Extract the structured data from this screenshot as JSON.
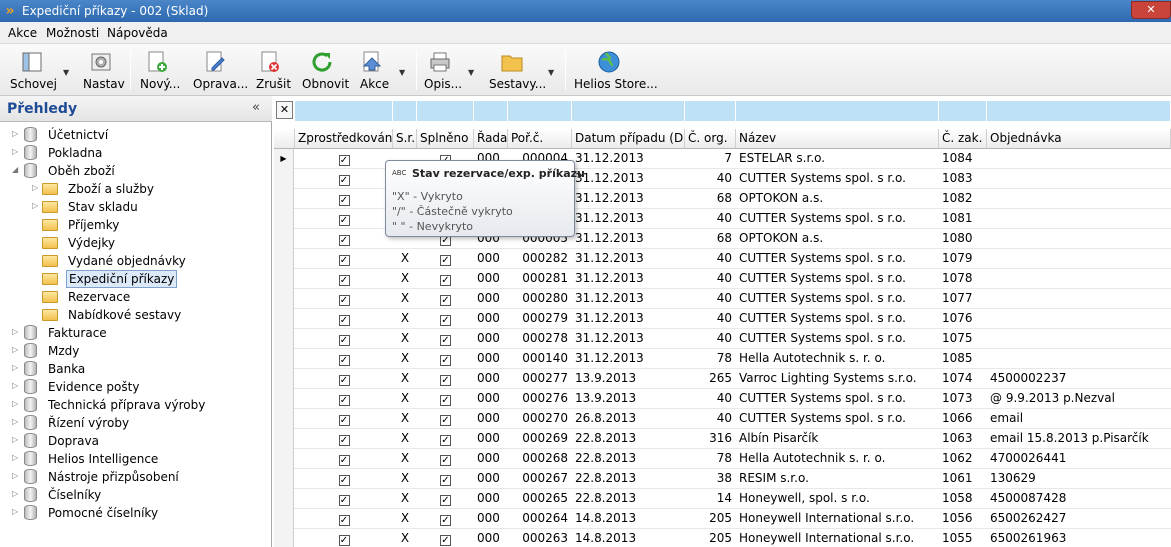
{
  "window": {
    "title": "Expediční příkazy - 002 (Sklad)",
    "close_glyph": "✕"
  },
  "menu": [
    "Akce",
    "Možnosti",
    "Nápověda"
  ],
  "toolbar": {
    "schovej": "Schovej",
    "nastav": "Nastav",
    "novy": "Nový...",
    "oprava": "Oprava...",
    "zrusit": "Zrušit",
    "obnovit": "Obnovit",
    "akce": "Akce",
    "opis": "Opis...",
    "sestavy": "Sestavy...",
    "helios_store": "Helios Store..."
  },
  "sidebar": {
    "title": "Přehledy",
    "collapse_glyph": "«",
    "items": [
      {
        "label": "Účetnictví",
        "level": 0,
        "type": "db",
        "expanded": false
      },
      {
        "label": "Pokladna",
        "level": 0,
        "type": "db",
        "expanded": false
      },
      {
        "label": "Oběh zboží",
        "level": 0,
        "type": "db",
        "expanded": true
      },
      {
        "label": "Zboží a služby",
        "level": 1,
        "type": "folder",
        "expandable": true
      },
      {
        "label": "Stav skladu",
        "level": 1,
        "type": "folder",
        "expandable": true
      },
      {
        "label": "Příjemky",
        "level": 1,
        "type": "folder",
        "expandable": false
      },
      {
        "label": "Výdejky",
        "level": 1,
        "type": "folder",
        "expandable": false
      },
      {
        "label": "Vydané objednávky",
        "level": 1,
        "type": "folder",
        "expandable": false
      },
      {
        "label": "Expediční příkazy",
        "level": 1,
        "type": "folder",
        "expandable": false,
        "selected": true
      },
      {
        "label": "Rezervace",
        "level": 1,
        "type": "folder",
        "expandable": false
      },
      {
        "label": "Nabídkové sestavy",
        "level": 1,
        "type": "folder",
        "expandable": false
      },
      {
        "label": "Fakturace",
        "level": 0,
        "type": "db",
        "expanded": false
      },
      {
        "label": "Mzdy",
        "level": 0,
        "type": "db",
        "expanded": false
      },
      {
        "label": "Banka",
        "level": 0,
        "type": "db",
        "expanded": false
      },
      {
        "label": "Evidence pošty",
        "level": 0,
        "type": "db",
        "expanded": false
      },
      {
        "label": "Technická příprava výroby",
        "level": 0,
        "type": "db",
        "expanded": false
      },
      {
        "label": "Řízení výroby",
        "level": 0,
        "type": "db",
        "expanded": false
      },
      {
        "label": "Doprava",
        "level": 0,
        "type": "db",
        "expanded": false
      },
      {
        "label": "Helios Intelligence",
        "level": 0,
        "type": "db",
        "expanded": false
      },
      {
        "label": "Nástroje přizpůsobení",
        "level": 0,
        "type": "db",
        "expanded": false
      },
      {
        "label": "Číselníky",
        "level": 0,
        "type": "db",
        "expanded": false
      },
      {
        "label": "Pomocné číselníky",
        "level": 0,
        "type": "db",
        "expanded": false
      }
    ]
  },
  "grid": {
    "filter_close": "✕",
    "columns": [
      "Zprostředkováno",
      "S.r.",
      "Splněno",
      "Řada",
      "Poř.č.",
      "Datum případu (D...",
      "Č. org.",
      "Název",
      "Č. zak.",
      "Objednávka"
    ],
    "rows": [
      [
        "1",
        "",
        "1",
        "000",
        "000004",
        "31.12.2013",
        "7",
        "ESTELAR s.r.o.",
        "1084",
        ""
      ],
      [
        "1",
        "",
        "1",
        "000",
        "000003",
        "31.12.2013",
        "40",
        "CUTTER Systems spol. s r.o.",
        "1083",
        ""
      ],
      [
        "1",
        "",
        "1",
        "000",
        "000002",
        "31.12.2013",
        "68",
        "OPTOKON a.s.",
        "1082",
        ""
      ],
      [
        "1",
        "",
        "1",
        "000",
        "000001",
        "31.12.2013",
        "40",
        "CUTTER Systems spol. s r.o.",
        "1081",
        ""
      ],
      [
        "1",
        "",
        "1",
        "000",
        "000005",
        "31.12.2013",
        "68",
        "OPTOKON a.s.",
        "1080",
        ""
      ],
      [
        "1",
        "X",
        "1",
        "000",
        "000282",
        "31.12.2013",
        "40",
        "CUTTER Systems spol. s r.o.",
        "1079",
        ""
      ],
      [
        "1",
        "X",
        "1",
        "000",
        "000281",
        "31.12.2013",
        "40",
        "CUTTER Systems spol. s r.o.",
        "1078",
        ""
      ],
      [
        "1",
        "X",
        "1",
        "000",
        "000280",
        "31.12.2013",
        "40",
        "CUTTER Systems spol. s r.o.",
        "1077",
        ""
      ],
      [
        "1",
        "X",
        "1",
        "000",
        "000279",
        "31.12.2013",
        "40",
        "CUTTER Systems spol. s r.o.",
        "1076",
        ""
      ],
      [
        "1",
        "X",
        "1",
        "000",
        "000278",
        "31.12.2013",
        "40",
        "CUTTER Systems spol. s r.o.",
        "1075",
        ""
      ],
      [
        "1",
        "X",
        "1",
        "000",
        "000140",
        "31.12.2013",
        "78",
        "Hella Autotechnik s. r. o.",
        "1085",
        ""
      ],
      [
        "1",
        "X",
        "1",
        "000",
        "000277",
        "13.9.2013",
        "265",
        "Varroc Lighting Systems s.r.o.",
        "1074",
        "4500002237"
      ],
      [
        "1",
        "X",
        "1",
        "000",
        "000276",
        "13.9.2013",
        "40",
        "CUTTER Systems spol. s r.o.",
        "1073",
        "@ 9.9.2013 p.Nezval"
      ],
      [
        "1",
        "X",
        "1",
        "000",
        "000270",
        "26.8.2013",
        "40",
        "CUTTER Systems spol. s r.o.",
        "1066",
        "email"
      ],
      [
        "1",
        "X",
        "1",
        "000",
        "000269",
        "22.8.2013",
        "316",
        "Albín Pisarčík",
        "1063",
        "email 15.8.2013 p.Pisarčík"
      ],
      [
        "1",
        "X",
        "1",
        "000",
        "000268",
        "22.8.2013",
        "78",
        "Hella Autotechnik s. r. o.",
        "1062",
        "4700026441"
      ],
      [
        "1",
        "X",
        "1",
        "000",
        "000267",
        "22.8.2013",
        "38",
        "RESIM s.r.o.",
        "1061",
        "130629"
      ],
      [
        "1",
        "X",
        "1",
        "000",
        "000265",
        "22.8.2013",
        "14",
        "Honeywell, spol. s r.o.",
        "1058",
        "4500087428"
      ],
      [
        "1",
        "X",
        "1",
        "000",
        "000264",
        "14.8.2013",
        "205",
        "Honeywell International s.r.o.",
        "1056",
        "6500262427"
      ],
      [
        "1",
        "X",
        "1",
        "000",
        "000263",
        "14.8.2013",
        "205",
        "Honeywell International s.r.o.",
        "1055",
        "6500261963"
      ]
    ]
  },
  "tooltip": {
    "abc": "ABC",
    "title": "Stav rezervace/exp. příkazu",
    "lines": [
      "\"X\" - Vykryto",
      "\"/\" - Částečně vykryto",
      "\" \" - Nevykryto"
    ]
  },
  "colors": {
    "titlebar": "#2d68b0",
    "filter_bar": "#bfe1f5",
    "selection": "#dce9f8",
    "sidebar_title": "#1e4b96"
  }
}
